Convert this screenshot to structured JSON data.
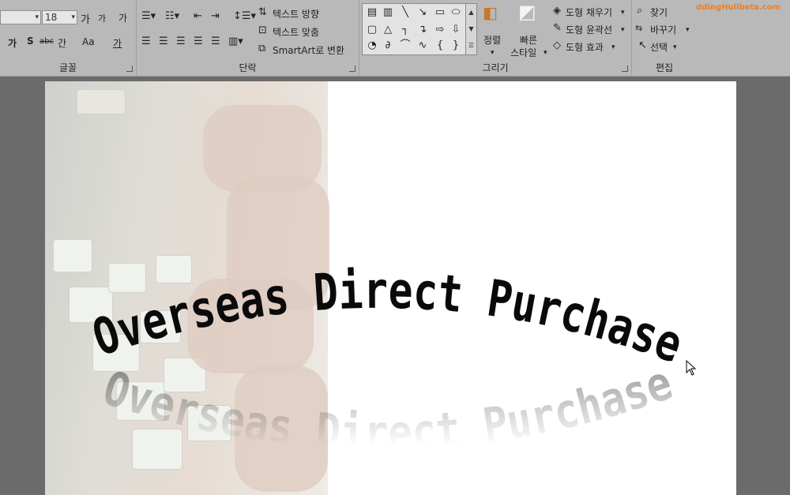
{
  "watermark": "ddingHulibeta.com",
  "ribbon": {
    "font_group": {
      "label": "글꼴",
      "font_size": "18",
      "grow_label": "가",
      "shrink_label": "가",
      "clear_label": "가",
      "bold_label": "가",
      "shadow_label": "S",
      "strike_label": "abc",
      "spacing_label": "간",
      "case_label": "Aa",
      "color_label": "가"
    },
    "paragraph_group": {
      "label": "단락",
      "text_direction": "텍스트 방향",
      "align_text": "텍스트 맞춤",
      "smartart": "SmartArt로 변환"
    },
    "drawing_group": {
      "label": "그리기",
      "arrange": "정렬",
      "quick_styles_1": "빠른",
      "quick_styles_2": "스타일",
      "shape_fill": "도형 채우기",
      "shape_outline": "도형 윤곽선",
      "shape_effects": "도형 효과"
    },
    "editing_group": {
      "label": "편집",
      "find": "찾기",
      "replace": "바꾸기",
      "select": "선택"
    }
  },
  "slide": {
    "title": "Overseas Direct Purchase"
  }
}
